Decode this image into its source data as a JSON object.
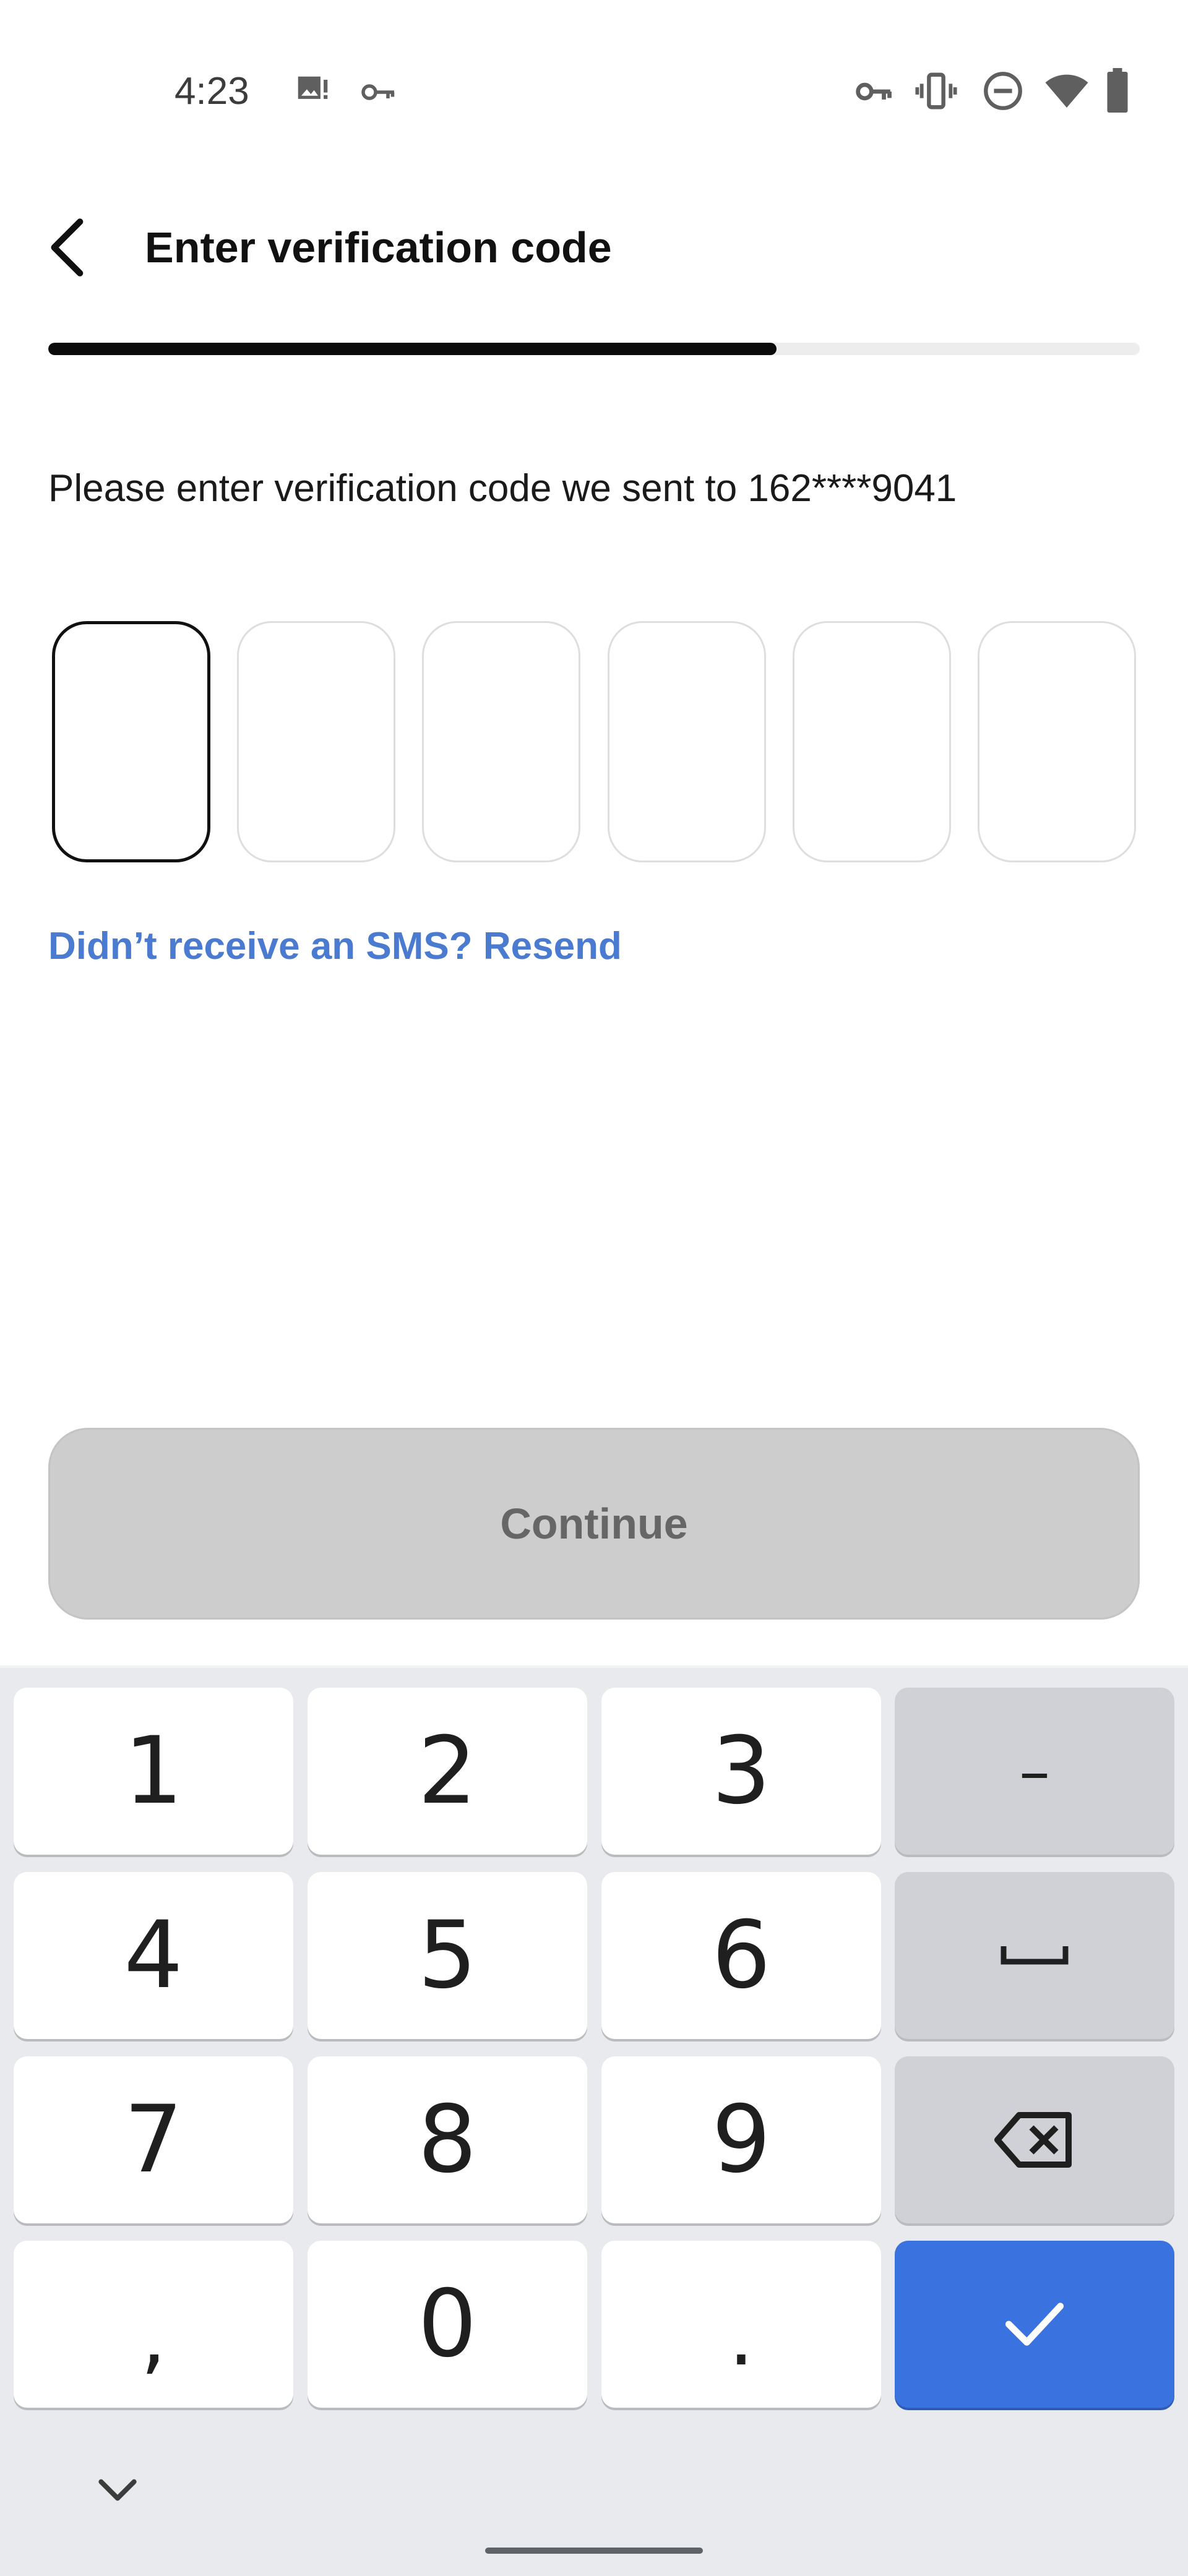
{
  "status_bar": {
    "time": "4:23",
    "icons_left": [
      "image-alert-icon",
      "key-icon"
    ],
    "icons_right": [
      "vpn-key-icon",
      "vibrate-icon",
      "do-not-disturb-icon",
      "wifi-icon",
      "battery-icon"
    ]
  },
  "header": {
    "title": "Enter verification code",
    "back_icon": "chevron-left-icon"
  },
  "progress": {
    "value": 0.667
  },
  "instruction": "Please enter verification code we sent to 162****9041",
  "code": {
    "length": 6,
    "active_index": 0,
    "values": [
      "",
      "",
      "",
      "",
      "",
      ""
    ]
  },
  "resend_label": "Didn’t receive an SMS? Resend",
  "continue_label": "Continue",
  "keyboard": {
    "keys": [
      [
        "1",
        "2",
        "3",
        "–"
      ],
      [
        "4",
        "5",
        "6",
        "␣"
      ],
      [
        "7",
        "8",
        "9",
        "⌫"
      ],
      [
        ",",
        "0",
        ".",
        "✓"
      ]
    ],
    "hide_icon": "chevron-down-icon"
  },
  "colors": {
    "accent": "#4a7bd0",
    "enter_key": "#3a72e0",
    "progress_fill": "#0b0b0b",
    "button_disabled": "#cdcdcd"
  }
}
